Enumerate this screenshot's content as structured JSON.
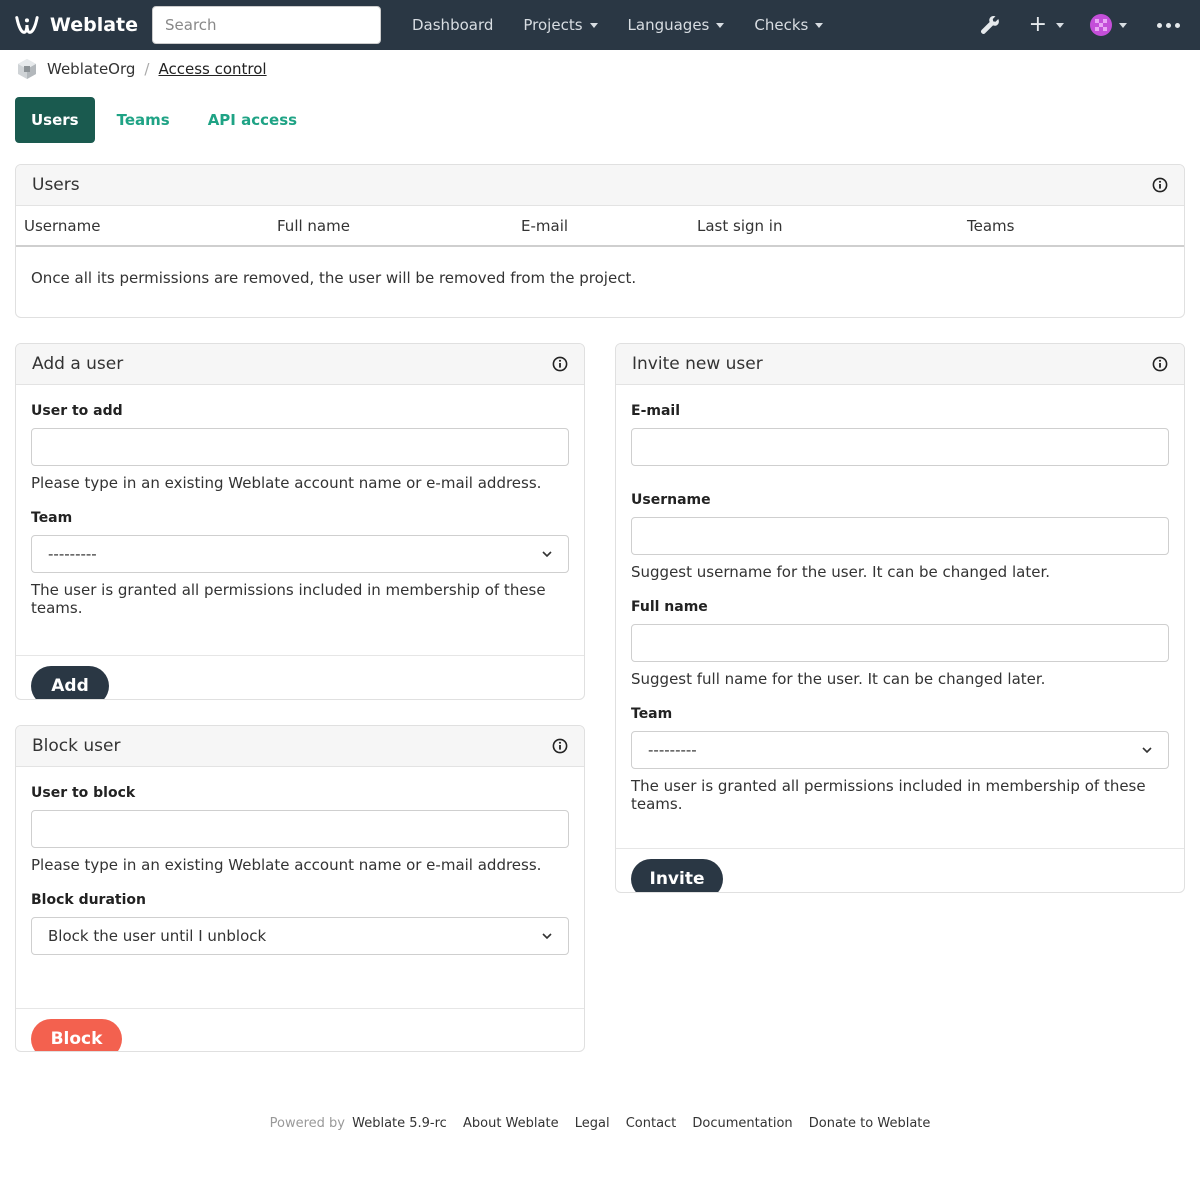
{
  "navbar": {
    "brand": "Weblate",
    "search_placeholder": "Search",
    "items": [
      {
        "label": "Dashboard",
        "dropdown": false
      },
      {
        "label": "Projects",
        "dropdown": true
      },
      {
        "label": "Languages",
        "dropdown": true
      },
      {
        "label": "Checks",
        "dropdown": true
      }
    ],
    "right_icons": [
      "wrench-icon",
      "plus-icon",
      "avatar-icon",
      "more-icon"
    ]
  },
  "breadcrumb": {
    "org": "WeblateOrg",
    "current": "Access control"
  },
  "tabs": [
    {
      "label": "Users",
      "active": true
    },
    {
      "label": "Teams",
      "active": false
    },
    {
      "label": "API access",
      "active": false
    }
  ],
  "users_card": {
    "title": "Users",
    "columns": [
      "Username",
      "Full name",
      "E-mail",
      "Last sign in",
      "Teams"
    ],
    "note": "Once all its permissions are removed, the user will be removed from the project."
  },
  "add_user": {
    "title": "Add a user",
    "user_label": "User to add",
    "user_help": "Please type in an existing Weblate account name or e-mail address.",
    "team_label": "Team",
    "team_value": "---------",
    "team_help": "The user is granted all permissions included in membership of these teams.",
    "button": "Add"
  },
  "block_user": {
    "title": "Block user",
    "user_label": "User to block",
    "user_help": "Please type in an existing Weblate account name or e-mail address.",
    "duration_label": "Block duration",
    "duration_value": "Block the user until I unblock",
    "button": "Block"
  },
  "invite_user": {
    "title": "Invite new user",
    "email_label": "E-mail",
    "username_label": "Username",
    "username_help": "Suggest username for the user. It can be changed later.",
    "fullname_label": "Full name",
    "fullname_help": "Suggest full name for the user. It can be changed later.",
    "team_label": "Team",
    "team_value": "---------",
    "team_help": "The user is granted all permissions included in membership of these teams.",
    "button": "Invite"
  },
  "footer": {
    "powered_by": "Powered by",
    "version": "Weblate 5.9-rc",
    "links": [
      "About Weblate",
      "Legal",
      "Contact",
      "Documentation",
      "Donate to Weblate"
    ]
  },
  "colors": {
    "navbar": "#2a3744",
    "accent": "#1fa385",
    "active_tab": "#1a5a4f",
    "danger": "#f3614f"
  }
}
